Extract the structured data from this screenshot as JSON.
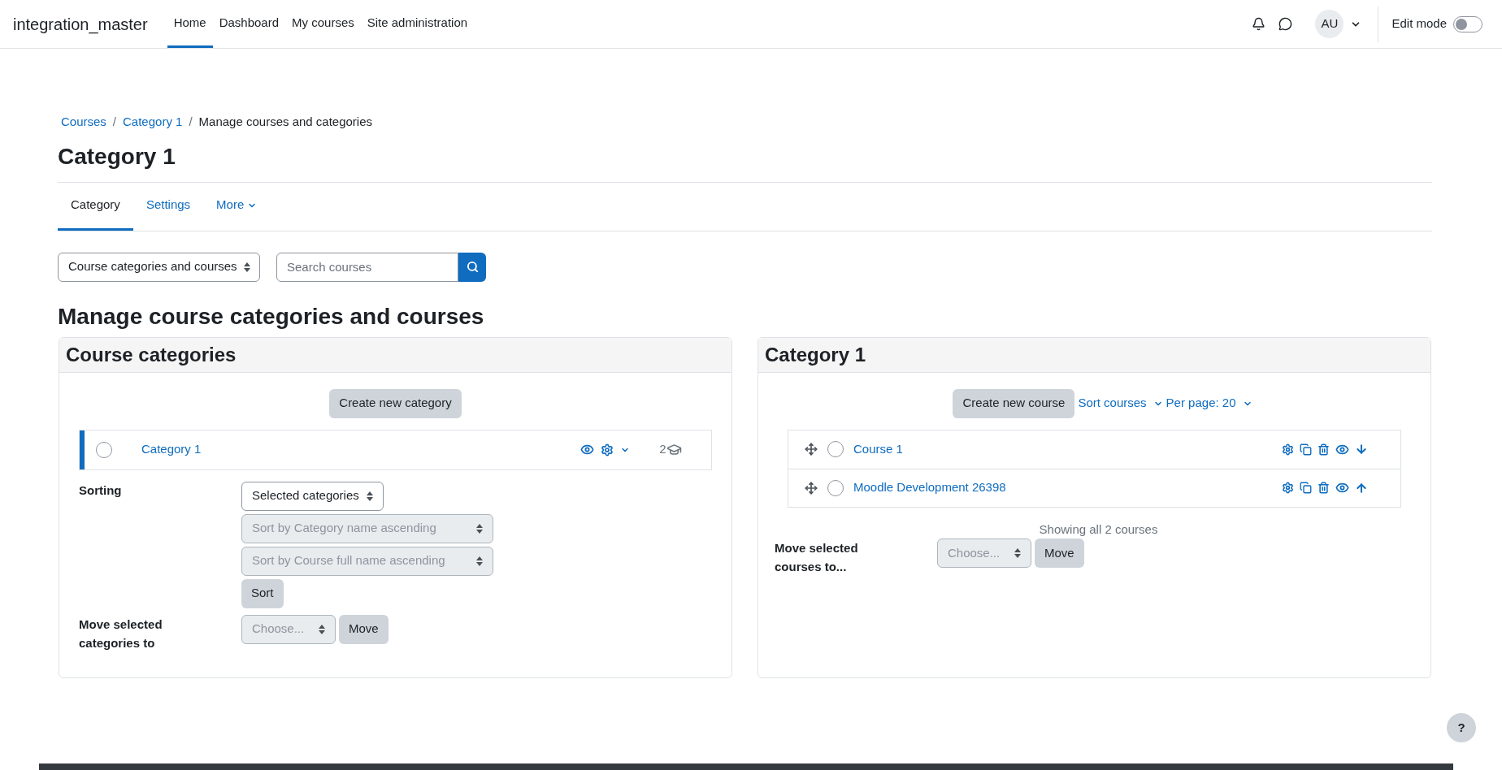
{
  "site_name": "integration_master",
  "nav": [
    {
      "label": "Home",
      "selected": true
    },
    {
      "label": "Dashboard",
      "selected": false
    },
    {
      "label": "My courses",
      "selected": false
    },
    {
      "label": "Site administration",
      "selected": false
    }
  ],
  "user": {
    "initials": "AU"
  },
  "edit_mode": {
    "label": "Edit mode",
    "on": false
  },
  "breadcrumb": [
    {
      "label": "Courses",
      "link": true
    },
    {
      "label": "Category 1",
      "link": true,
      "separator": "/"
    },
    {
      "label": "Manage courses and categories",
      "link": false,
      "separator": "/"
    }
  ],
  "page_title": "Category 1",
  "tabs": [
    {
      "label": "Category",
      "selected": true,
      "dropdown": false
    },
    {
      "label": "Settings",
      "selected": false,
      "dropdown": false
    },
    {
      "label": "More",
      "selected": false,
      "dropdown": true
    }
  ],
  "view_select": {
    "value": "Course categories and courses"
  },
  "search": {
    "placeholder": "Search courses"
  },
  "heading": "Manage course categories and courses",
  "categories_panel": {
    "title": "Course categories",
    "create_button": "Create new category",
    "categories": [
      {
        "name": "Category 1",
        "checked": false,
        "selected": true,
        "course_count": "2"
      }
    ],
    "sorting": {
      "label": "Sorting",
      "selects": [
        {
          "value": "Selected categories",
          "disabled": false
        },
        {
          "value": "Sort by Category name ascending",
          "disabled": true
        },
        {
          "value": "Sort by Course full name ascending",
          "disabled": true
        }
      ],
      "button": "Sort"
    },
    "move": {
      "label": "Move selected categories to",
      "placeholder": "Choose...",
      "disabled": true,
      "button": "Move"
    }
  },
  "courses_panel": {
    "title": "Category 1",
    "create_button": "Create new course",
    "sort_link": "Sort courses",
    "per_page_link": "Per page: 20",
    "courses": [
      {
        "name": "Course 1",
        "checked": false,
        "kind": "move-down"
      },
      {
        "name": "Moodle Development 26398",
        "checked": false,
        "kind": "move-up"
      }
    ],
    "summary": "Showing all 2 courses",
    "move": {
      "label": "Move selected courses to...",
      "placeholder": "Choose...",
      "disabled": true,
      "button": "Move"
    }
  },
  "help_button": "?"
}
